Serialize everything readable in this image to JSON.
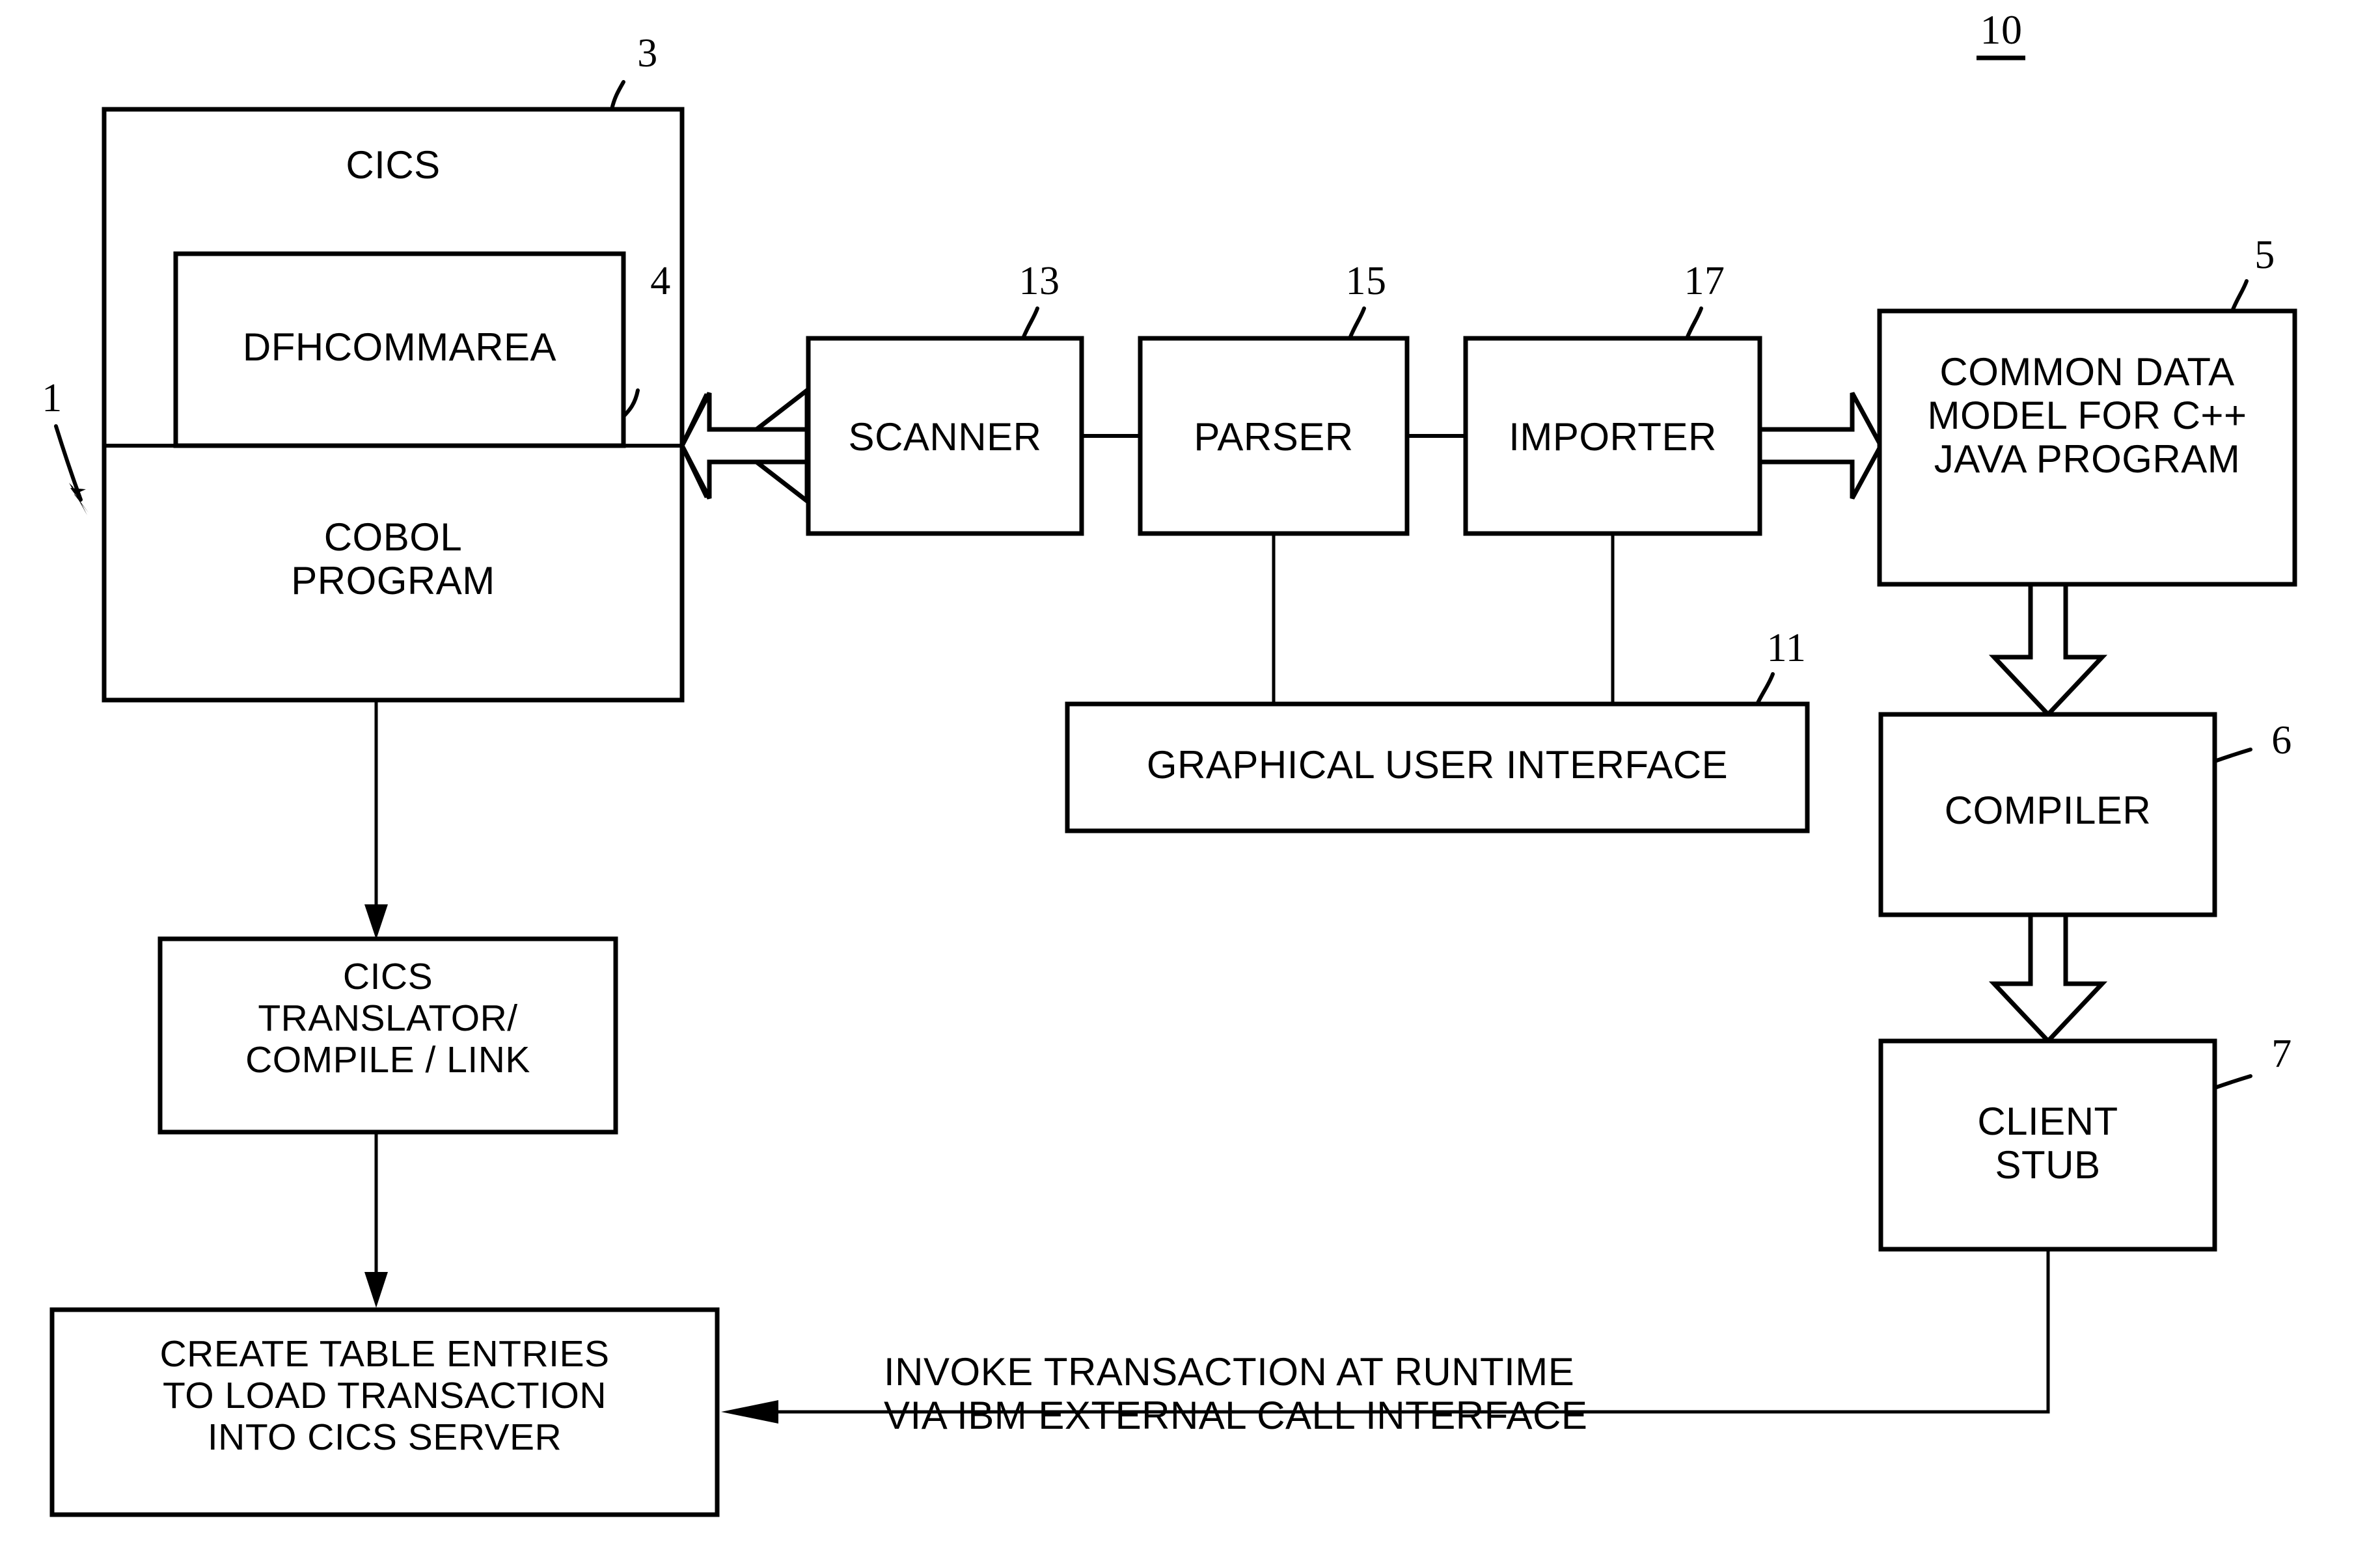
{
  "figure": {
    "reference_number": "10",
    "system_reference": "1"
  },
  "boxes": {
    "cics": {
      "label": "CICS",
      "ref": "3"
    },
    "dfhcommarea": {
      "label": "DFHCOMMAREA",
      "ref": "4"
    },
    "cobol_program": {
      "label": "COBOL\nPROGRAM"
    },
    "scanner": {
      "label": "SCANNER",
      "ref": "13"
    },
    "parser": {
      "label": "PARSER",
      "ref": "15"
    },
    "importer": {
      "label": "IMPORTER",
      "ref": "17"
    },
    "common_data_model": {
      "label": "COMMON DATA\nMODEL FOR C++\nJAVA PROGRAM",
      "ref": "5"
    },
    "gui": {
      "label": "GRAPHICAL USER INTERFACE",
      "ref": "11"
    },
    "compiler": {
      "label": "COMPILER",
      "ref": "6"
    },
    "client_stub": {
      "label": "CLIENT\nSTUB",
      "ref": "7"
    },
    "cics_translator": {
      "label": "CICS\nTRANSLATOR/\nCOMPILE / LINK"
    },
    "create_table_entries": {
      "label": "CREATE TABLE ENTRIES\nTO LOAD TRANSACTION\nINTO CICS SERVER"
    }
  },
  "annotations": {
    "invoke_transaction": "INVOKE TRANSACTION AT RUNTIME\nVIA IBM EXTERNAL CALL INTERFACE"
  },
  "colors": {
    "ink": "#000000",
    "paper": "#ffffff"
  }
}
